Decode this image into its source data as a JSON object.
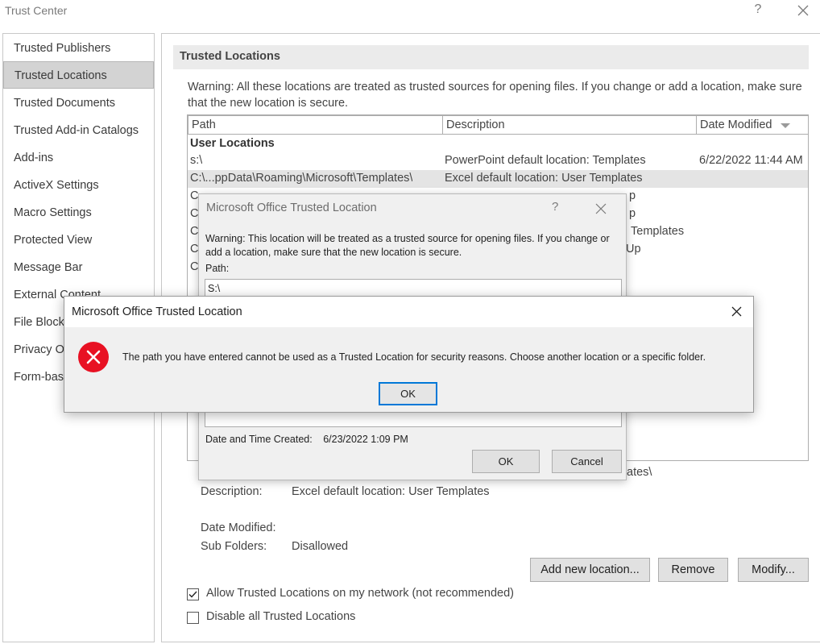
{
  "window": {
    "title": "Trust Center",
    "help": "?"
  },
  "sidebar": {
    "items": [
      {
        "label": "Trusted Publishers"
      },
      {
        "label": "Trusted Locations"
      },
      {
        "label": "Trusted Documents"
      },
      {
        "label": "Trusted Add-in Catalogs"
      },
      {
        "label": "Add-ins"
      },
      {
        "label": "ActiveX Settings"
      },
      {
        "label": "Macro Settings"
      },
      {
        "label": "Protected View"
      },
      {
        "label": "Message Bar"
      },
      {
        "label": "External Content"
      },
      {
        "label": "File Block"
      },
      {
        "label": "Privacy O"
      },
      {
        "label": "Form-bas"
      }
    ],
    "active_index": 1
  },
  "main": {
    "section_title": "Trusted Locations",
    "warning": "Warning: All these locations are treated as trusted sources for opening files.  If you change or add a location, make sure that the new location is secure.",
    "table": {
      "columns": [
        "Path",
        "Description",
        "Date Modified"
      ],
      "group": "User Locations",
      "rows": [
        {
          "path": "s:\\",
          "description": "PowerPoint default location: Templates",
          "date": "6/22/2022 11:44 AM"
        },
        {
          "path": "C:\\...ppData\\Roaming\\Microsoft\\Templates\\",
          "description": "Excel default location: User Templates",
          "date": ""
        }
      ],
      "partial_row_c_prefix": "C",
      "partial_desc_1": "p",
      "partial_desc_2": "p",
      "partial_desc_3": "Templates",
      "partial_desc_4": "Up",
      "partial_path_end": "ates\\"
    },
    "details": {
      "description_label": "Description:",
      "description_value": "Excel default location: User Templates",
      "date_modified_label": "Date Modified:",
      "date_modified_value": "",
      "subfolders_label": "Sub Folders:",
      "subfolders_value": "Disallowed"
    },
    "buttons": {
      "add": "Add new location...",
      "remove": "Remove",
      "modify": "Modify..."
    },
    "checkboxes": [
      {
        "label": "Allow Trusted Locations on my network (not recommended)",
        "checked": true
      },
      {
        "label": "Disable all Trusted Locations",
        "checked": false
      }
    ]
  },
  "trusted_location_dialog": {
    "title": "Microsoft Office Trusted Location",
    "help": "?",
    "warning": "Warning: This location will be treated as a trusted source for opening files. If you change or add a location, make sure that the new location is secure.",
    "path_label": "Path:",
    "path_value": "S:\\",
    "date_created_label": "Date and Time Created:",
    "date_created_value": "6/23/2022 1:09 PM",
    "ok": "OK",
    "cancel": "Cancel"
  },
  "error_dialog": {
    "title": "Microsoft Office Trusted Location",
    "message": "The path you have entered cannot be used as a Trusted Location for security reasons.  Choose another location or a specific folder.",
    "ok": "OK",
    "icon": "error-icon",
    "icon_color": "#e81123"
  }
}
